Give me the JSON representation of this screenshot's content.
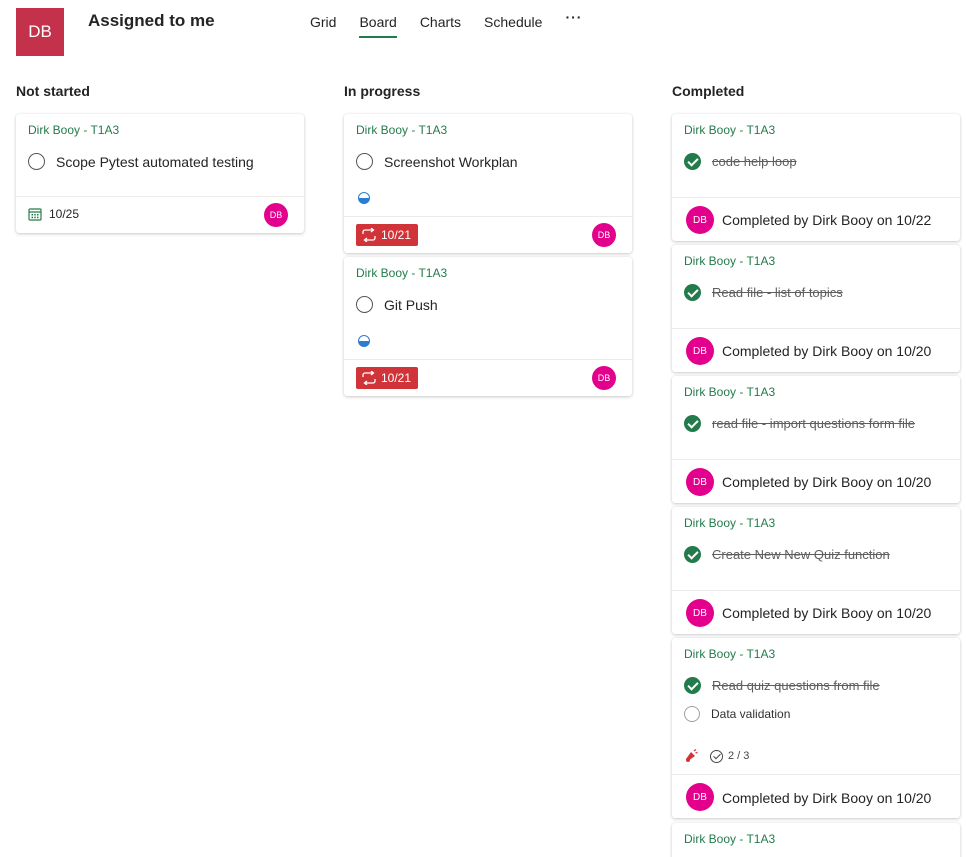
{
  "header": {
    "avatar_initials": "DB",
    "title": "Assigned to me",
    "tabs": [
      {
        "label": "Grid"
      },
      {
        "label": "Board",
        "active": true
      },
      {
        "label": "Charts"
      },
      {
        "label": "Schedule"
      }
    ],
    "more_label": "···"
  },
  "colors": {
    "accent": "#237b4b",
    "overdue": "#d13438",
    "avatar": "#e3008c",
    "app_avatar": "#c4314b"
  },
  "columns": [
    {
      "title": "Not started",
      "cards": [
        {
          "bucket": "Dirk Booy - T1A3",
          "title": "Scope Pytest automated testing",
          "due": "10/25",
          "assignee": "DB",
          "icon": "calendar-icon"
        }
      ]
    },
    {
      "title": "In progress",
      "cards": [
        {
          "bucket": "Dirk Booy - T1A3",
          "title": "Screenshot Workplan",
          "progress_icon": "half-circle-icon",
          "due": "10/21",
          "due_icon": "repeat-icon",
          "assignee": "DB"
        },
        {
          "bucket": "Dirk Booy - T1A3",
          "title": "Git Push",
          "progress_icon": "half-circle-icon",
          "due": "10/21",
          "due_icon": "repeat-icon",
          "assignee": "DB"
        }
      ]
    },
    {
      "title": "Completed",
      "cards": [
        {
          "bucket": "Dirk Booy - T1A3",
          "title": "code help loop",
          "assignee": "DB",
          "completed_by": "Completed by Dirk Booy on 10/22"
        },
        {
          "bucket": "Dirk Booy - T1A3",
          "title": "Read file - list of topics",
          "assignee": "DB",
          "completed_by": "Completed by Dirk Booy on 10/20"
        },
        {
          "bucket": "Dirk Booy - T1A3",
          "title": "read file - import questions form file",
          "assignee": "DB",
          "completed_by": "Completed by Dirk Booy on 10/20"
        },
        {
          "bucket": "Dirk Booy - T1A3",
          "title": "Create New New Quiz function",
          "assignee": "DB",
          "completed_by": "Completed by Dirk Booy on 10/20"
        },
        {
          "bucket": "Dirk Booy - T1A3",
          "title": "Read quiz questions from file",
          "subtask": "Data validation",
          "checklist": "2 / 3",
          "priority_icon": "urgent-icon",
          "assignee": "DB",
          "completed_by": "Completed by Dirk Booy on 10/20"
        },
        {
          "bucket": "Dirk Booy - T1A3"
        }
      ]
    }
  ]
}
